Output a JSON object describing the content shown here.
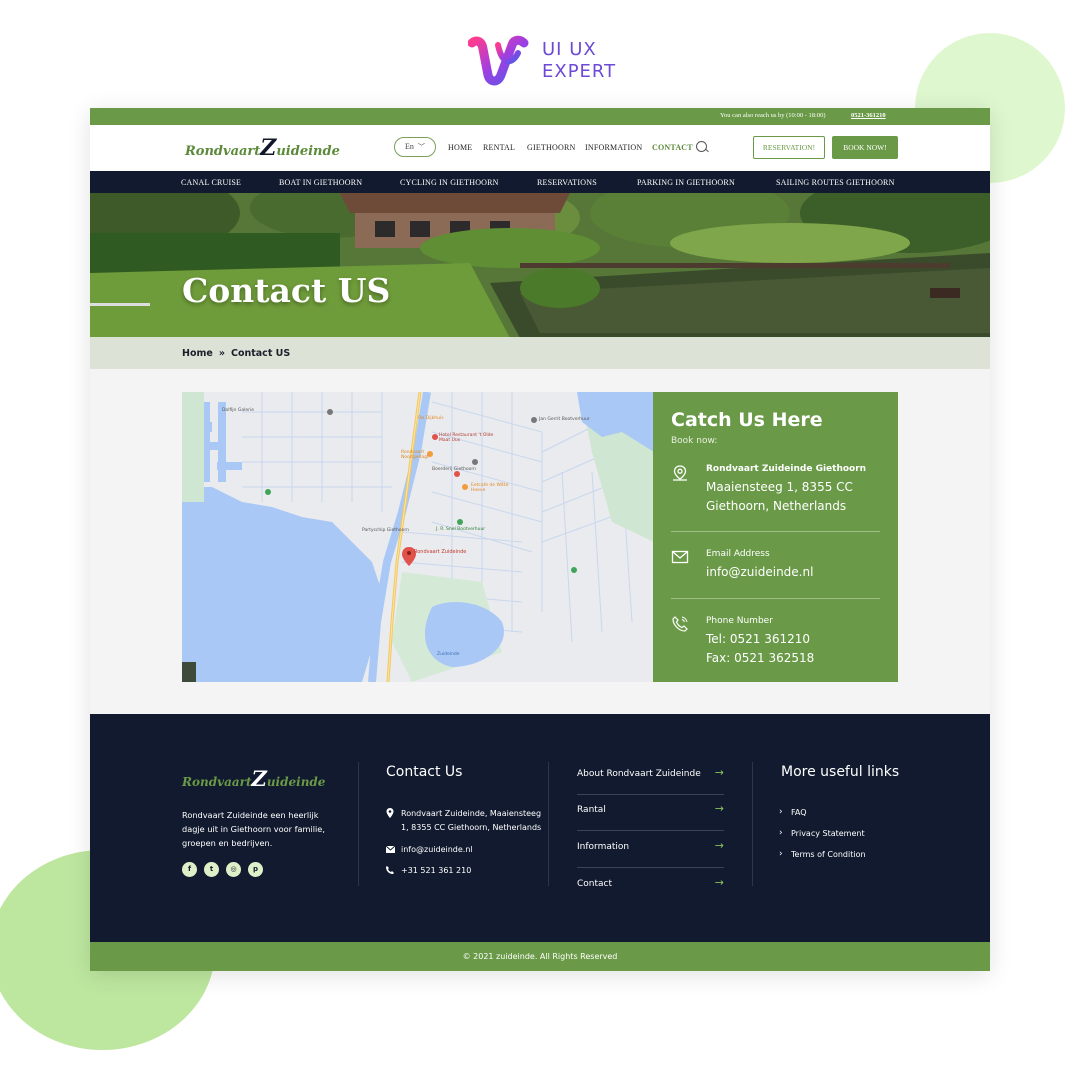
{
  "brand": {
    "line1": "UI UX",
    "line2": "EXPERT"
  },
  "topbar": {
    "text": "You can also reach us by (10:00 - 18:00)",
    "phone": "0521-361210"
  },
  "header": {
    "logo_part1": "Rondvaart",
    "logo_z": "Z",
    "logo_part2": "uideinde",
    "lang": "En",
    "nav": [
      "HOME",
      "RENTAL",
      "GIETHOORN",
      "INFORMATION",
      "CONTACT"
    ],
    "reservation_button": "RESERVATION!",
    "book_button": "BOOK NOW!"
  },
  "subnav": [
    "CANAL CRUISE",
    "BOAT IN GIETHOORN",
    "CYCLING IN GIETHOORN",
    "RESERVATIONS",
    "PARKING IN GIETHOORN",
    "SAILING ROUTES GIETHOORN"
  ],
  "hero": {
    "title": "Contact US"
  },
  "breadcrumb": {
    "home": "Home",
    "sep": "»",
    "current": "Contact US"
  },
  "map_labels": {
    "pin": "Rondvaart Zuideinde",
    "l1": "Hotel Restaurant 't Olde Maat Uus",
    "l2": "Partyschip Giethoorn",
    "l3": "J. R. Snel Bootverhuur",
    "l4": "Jan Gerrit Bootverhuur",
    "l5": "De Dijkhuis",
    "l6": "Zuideinde",
    "l7": "Rondvaart Nooitgedagt",
    "l8": "Boerderij Giethoorn",
    "l9": "Eetcafe de Witte Hoeve",
    "l10": "Dolfijn Galerie"
  },
  "contact_panel": {
    "title": "Catch Us Here",
    "subtitle": "Book now:",
    "address_label": "Rondvaart Zuideinde Giethoorn",
    "address_line1": "Maaiensteeg 1, 8355 CC",
    "address_line2": "Giethoorn, Netherlands",
    "email_label": "Email Address",
    "email": "info@zuideinde.nl",
    "phone_label": "Phone Number",
    "tel": "Tel: 0521 361210",
    "fax": "Fax: 0521 362518"
  },
  "footer": {
    "logo_part1": "Rondvaart",
    "logo_z": "Z",
    "logo_part2": "uideinde",
    "description": "Rondvaart Zuideinde een heerlijk dagje uit in Giethoorn voor familie, groepen en bedrijven.",
    "social": [
      "f",
      "t",
      "◎",
      "p"
    ],
    "contact_heading": "Contact Us",
    "contact_address": "Rondvaart Zuideinde, Maaiensteeg 1, 8355 CC Giethoorn, Netherlands",
    "contact_email": "info@zuideinde.nl",
    "contact_phone": "+31 521 361 210",
    "links": [
      "About Rondvaart Zuideinde",
      "Rantal",
      "Information",
      "Contact"
    ],
    "useful_heading": "More useful links",
    "useful_links": [
      "FAQ",
      "Privacy Statement",
      "Terms of Condition"
    ],
    "copyright": "© 2021 zuideinde. All Rights Reserved"
  },
  "colors": {
    "accent": "#6a9a47",
    "dark": "#111a2e",
    "crumb_bg": "#dce3d6",
    "page_bg": "#f4f4f5"
  }
}
